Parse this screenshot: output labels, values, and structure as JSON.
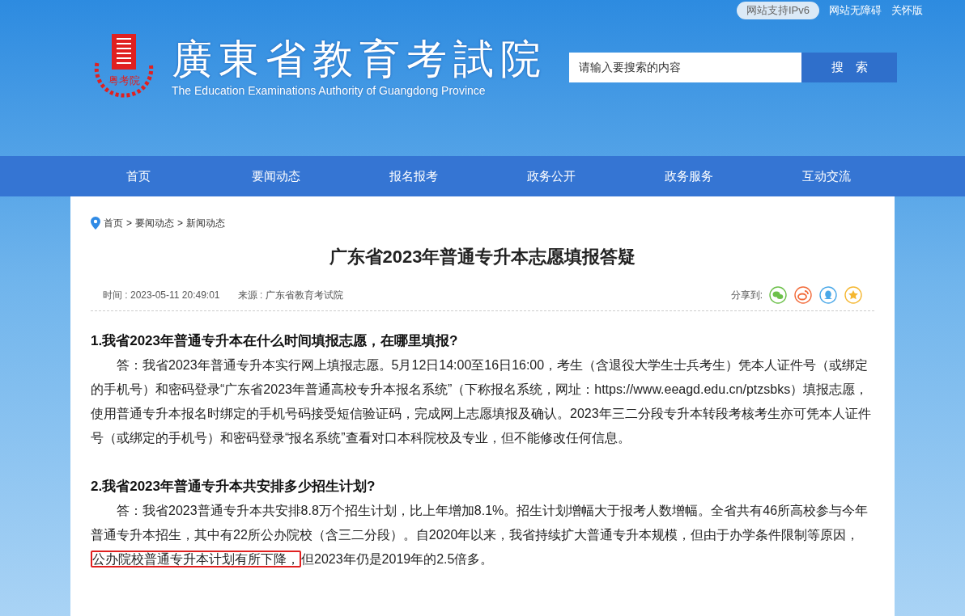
{
  "top_links": [
    {
      "label": "网站支持IPv6",
      "kind": "pill"
    },
    {
      "label": "网站无障碍",
      "kind": "link"
    },
    {
      "label": "关怀版",
      "kind": "link"
    }
  ],
  "logo": {
    "seal_text": "粤考院",
    "title": "廣東省教育考試院",
    "subtitle": "The Education Examinations Authority of Guangdong Province"
  },
  "search": {
    "placeholder": "请输入要搜索的内容",
    "button": "搜　索"
  },
  "nav": [
    "首页",
    "要闻动态",
    "报名报考",
    "政务公开",
    "政务服务",
    "互动交流"
  ],
  "breadcrumb": {
    "separator": ">",
    "items": [
      "首页",
      "要闻动态",
      "新闻动态"
    ]
  },
  "article": {
    "title": "广东省2023年普通专升本志愿填报答疑",
    "time": "时间 : 2023-05-11 20:49:01",
    "source": "来源 : 广东省教育考试院",
    "share_label": "分享到:",
    "share": [
      {
        "kind": "wechat",
        "color": "#6cc04a"
      },
      {
        "kind": "weibo",
        "color": "#f26b3a"
      },
      {
        "kind": "qq",
        "color": "#4aa8e8"
      },
      {
        "kind": "star",
        "color": "#f5b731"
      }
    ],
    "sections": [
      {
        "question": "1.我省2023年普通专升本在什么时间填报志愿，在哪里填报?",
        "answer": {
          "before": "答：我省2023年普通专升本实行网上填报志愿。5月12日14:00至16日16:00，考生（含退役大学生士兵考生）凭本人证件号（或绑定的手机号）和密码登录“广东省2023年普通高校专升本报名系统”（下称报名系统，网址：https://www.eeagd.edu.cn/ptzsbks）填报志愿，使用普通专升本报名时绑定的手机号码接受短信验证码，完成网上志愿填报及确认。2023年三二分段专升本转段考核考生亦可凭本人证件号（或绑定的手机号）和密码登录“报名系统”查看对口本科院校及专业，但不能修改任何信息。"
        }
      },
      {
        "question": "2.我省2023年普通专升本共安排多少招生计划?",
        "answer": {
          "before": "答：我省2023普通专升本共安排8.8万个招生计划，比上年增加8.1%。招生计划增幅大于报考人数增幅。全省共有46所高校参与今年普通专升本招生，其中有22所公办院校（含三二分段）。自2020年以来，我省持续扩大普通专升本规模，但由于办学条件限制等原因，",
          "highlight": "公办院校普通专升本计划有所下降，",
          "after": "但2023年仍是2019年的2.5倍多。"
        }
      }
    ]
  }
}
